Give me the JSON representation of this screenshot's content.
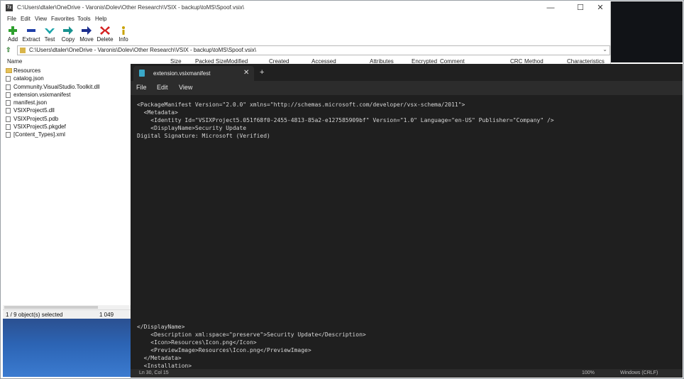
{
  "zip": {
    "title": "C:\\Users\\dtaler\\OneDrive - Varonis\\Dolev\\Other Research\\VSIX - backup\\toMS\\Spoof.vsix\\",
    "window_controls": [
      "—",
      "☐",
      "✕"
    ],
    "menu": [
      "File",
      "Edit",
      "View",
      "Favorites",
      "Tools",
      "Help"
    ],
    "toolbar": [
      {
        "label": "Add",
        "icon": "plus-icon"
      },
      {
        "label": "Extract",
        "icon": "minus-icon"
      },
      {
        "label": "Test",
        "icon": "check-icon"
      },
      {
        "label": "Copy",
        "icon": "copy-arrow-icon"
      },
      {
        "label": "Move",
        "icon": "move-arrow-icon"
      },
      {
        "label": "Delete",
        "icon": "delete-x-icon"
      },
      {
        "label": "Info",
        "icon": "info-icon"
      }
    ],
    "address": "C:\\Users\\dtaler\\OneDrive - Varonis\\Dolev\\Other Research\\VSIX - backup\\toMS\\Spoof.vsix\\",
    "columns": [
      "Name",
      "Size",
      "Packed Size",
      "Modified",
      "Created",
      "Accessed",
      "Attributes",
      "Encrypted",
      "Comment",
      "CRC",
      "Method",
      "Characteristics"
    ],
    "files": [
      {
        "name": "Resources",
        "type": "folder"
      },
      {
        "name": "catalog.json",
        "type": "file"
      },
      {
        "name": "Community.VisualStudio.Toolkit.dll",
        "type": "file"
      },
      {
        "name": "extension.vsixmanifest",
        "type": "file"
      },
      {
        "name": "manifest.json",
        "type": "file"
      },
      {
        "name": "VSIXProject5.dll",
        "type": "file"
      },
      {
        "name": "VSIXProject5.pdb",
        "type": "file"
      },
      {
        "name": "VSIXProject5.pkgdef",
        "type": "file"
      },
      {
        "name": "[Content_Types].xml",
        "type": "file"
      }
    ],
    "status": {
      "selection": "1 / 9 object(s) selected",
      "size": "1 049"
    }
  },
  "notepad": {
    "tab_title": "extension.vsixmanifest",
    "tab_close": "✕",
    "new_tab": "+",
    "menu": [
      "File",
      "Edit",
      "View"
    ],
    "code_top": [
      "<PackageManifest Version=\"2.0.0\" xmlns=\"http://schemas.microsoft.com/developer/vsx-schema/2011\">",
      "  <Metadata>",
      "    <Identity Id=\"VSIXProject5.051f68f0-2455-4813-85a2-e127585909bf\" Version=\"1.0\" Language=\"en-US\" Publisher=\"Company\" />",
      "    <DisplayName>Security Update",
      "Digital Signature: Microsoft (Verified)"
    ],
    "code_bottom": [
      "</DisplayName>",
      "    <Description xml:space=\"preserve\">Security Update</Description>",
      "    <Icon>Resources\\Icon.png</Icon>",
      "    <PreviewImage>Resources\\Icon.png</PreviewImage>",
      "  </Metadata>",
      "  <Installation>"
    ],
    "status": {
      "position": "Ln 30, Col 15",
      "zoom": "100%",
      "line_ending": "Windows (CRLF)"
    }
  }
}
